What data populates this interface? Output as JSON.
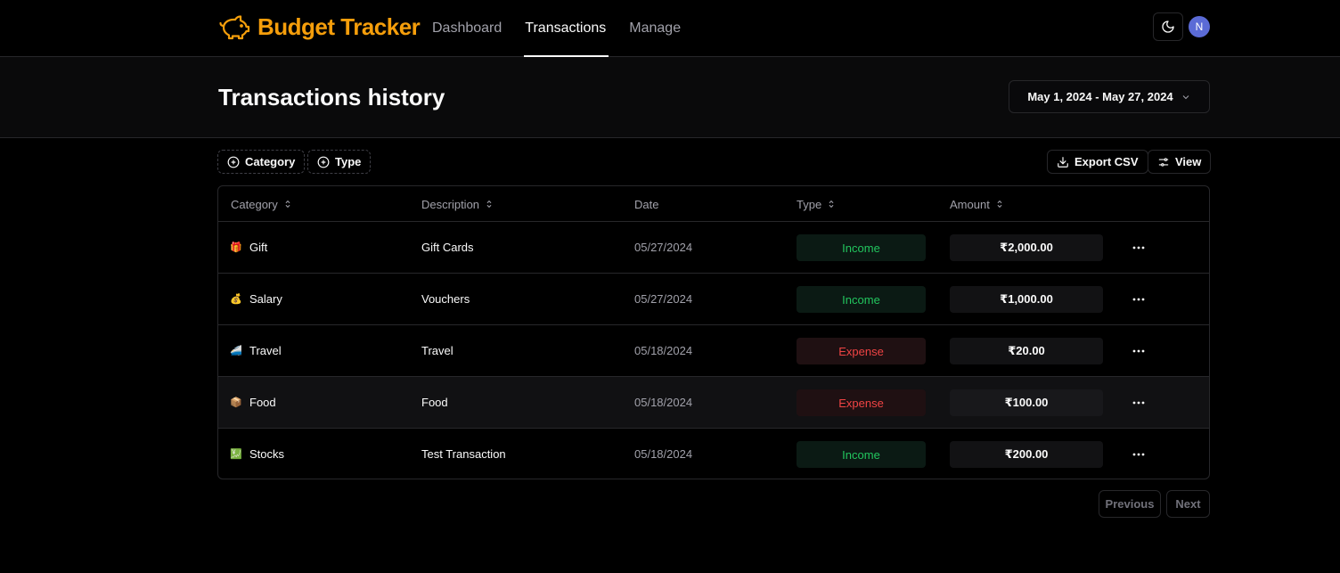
{
  "app": {
    "name": "Budget Tracker",
    "brand_color": "#f59e0b"
  },
  "nav": {
    "items": [
      {
        "label": "Dashboard",
        "active": false
      },
      {
        "label": "Transactions",
        "active": true
      },
      {
        "label": "Manage",
        "active": false
      }
    ],
    "theme_icon": "moon-icon",
    "avatar_initial": "N"
  },
  "header": {
    "title": "Transactions history",
    "date_range": "May 1, 2024 - May 27, 2024"
  },
  "filters": {
    "category_label": "Category",
    "type_label": "Type",
    "export_label": "Export CSV",
    "view_label": "View"
  },
  "table": {
    "columns": [
      "Category",
      "Description",
      "Date",
      "Type",
      "Amount"
    ],
    "rows": [
      {
        "icon": "🎁",
        "category": "Gift",
        "description": "Gift Cards",
        "date": "05/27/2024",
        "type": "Income",
        "amount": "₹2,000.00"
      },
      {
        "icon": "💰",
        "category": "Salary",
        "description": "Vouchers",
        "date": "05/27/2024",
        "type": "Income",
        "amount": "₹1,000.00"
      },
      {
        "icon": "🚄",
        "category": "Travel",
        "description": "Travel",
        "date": "05/18/2024",
        "type": "Expense",
        "amount": "₹20.00"
      },
      {
        "icon": "📦",
        "category": "Food",
        "description": "Food",
        "date": "05/18/2024",
        "type": "Expense",
        "amount": "₹100.00"
      },
      {
        "icon": "💹",
        "category": "Stocks",
        "description": "Test Transaction",
        "date": "05/18/2024",
        "type": "Income",
        "amount": "₹200.00"
      }
    ]
  },
  "pagination": {
    "previous_label": "Previous",
    "next_label": "Next"
  },
  "colors": {
    "income": "#22c55e",
    "expense": "#ef4444",
    "avatar": "#5b6bd6"
  }
}
